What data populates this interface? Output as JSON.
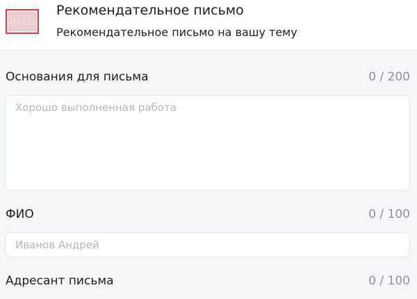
{
  "header": {
    "thumbnail_text": "HELLO",
    "title": "Рекомендательное письмо",
    "subtitle": "Рекомендательное письмо на вашу тему"
  },
  "fields": [
    {
      "label": "Основания для письма",
      "counter": "0 / 200",
      "placeholder": "Хорошо выполненная работа",
      "type": "textarea"
    },
    {
      "label": "ФИО",
      "counter": "0 / 100",
      "placeholder": "Иванов Андрей",
      "type": "input"
    },
    {
      "label": "Адресант письма",
      "counter": "0 / 100"
    }
  ],
  "colors": {
    "background": "#f5f6f8",
    "text": "#1c1c1e",
    "muted": "#8e9096",
    "placeholder": "#b4b6bc",
    "border": "#e3e5e9"
  }
}
